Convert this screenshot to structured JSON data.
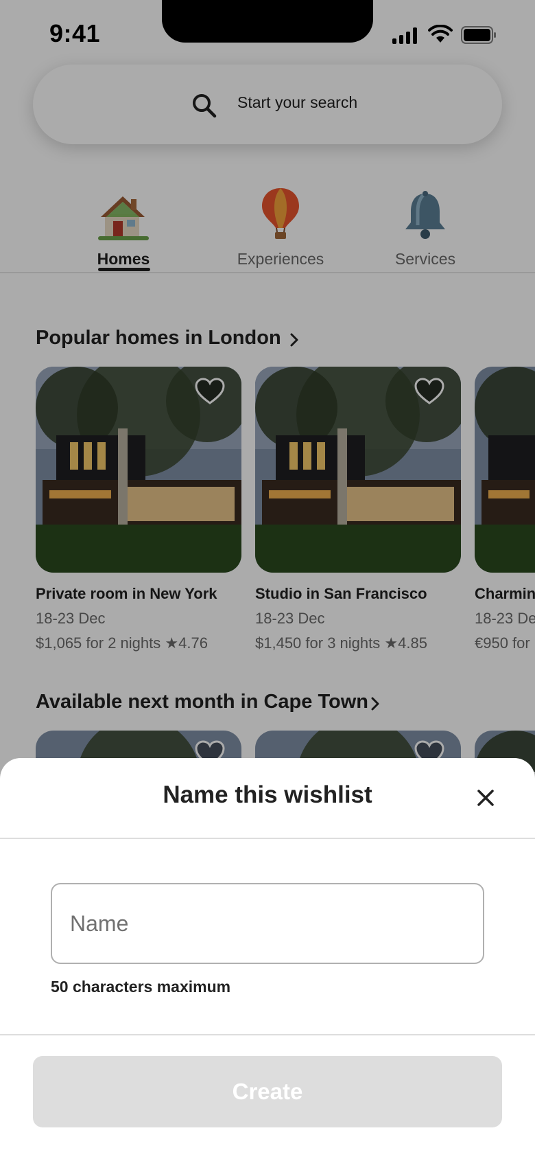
{
  "status_bar": {
    "time": "9:41"
  },
  "search": {
    "placeholder": "Start your search"
  },
  "categories": [
    {
      "label": "Homes",
      "icon": "house-icon",
      "active": true
    },
    {
      "label": "Experiences",
      "icon": "hot-air-balloon-icon",
      "active": false
    },
    {
      "label": "Services",
      "icon": "bell-icon",
      "active": false
    }
  ],
  "sections": [
    {
      "title": "Popular homes in London",
      "cards": [
        {
          "title": "Private room in New York",
          "dates": "18-23 Dec",
          "price": "$1,065  for 2 nights",
          "rating": "4.76"
        },
        {
          "title": "Studio in San Francisco",
          "dates": "18-23 Dec",
          "price": "$1,450 for 3 nights",
          "rating": "4.85"
        },
        {
          "title": "Charmin",
          "dates": "18-23 De",
          "price": "€950 for",
          "rating": ""
        }
      ]
    },
    {
      "title": "Available next month in Cape Town"
    }
  ],
  "wishlist_sheet": {
    "title": "Name this wishlist",
    "input_placeholder": "Name",
    "input_value": "",
    "hint": "50 characters maximum",
    "create_label": "Create"
  },
  "colors": {
    "overlay": "rgba(0,0,0,0.33)",
    "button_disabled": "#dddddd",
    "text": "#222222",
    "secondary_text": "#6a6a6a"
  }
}
